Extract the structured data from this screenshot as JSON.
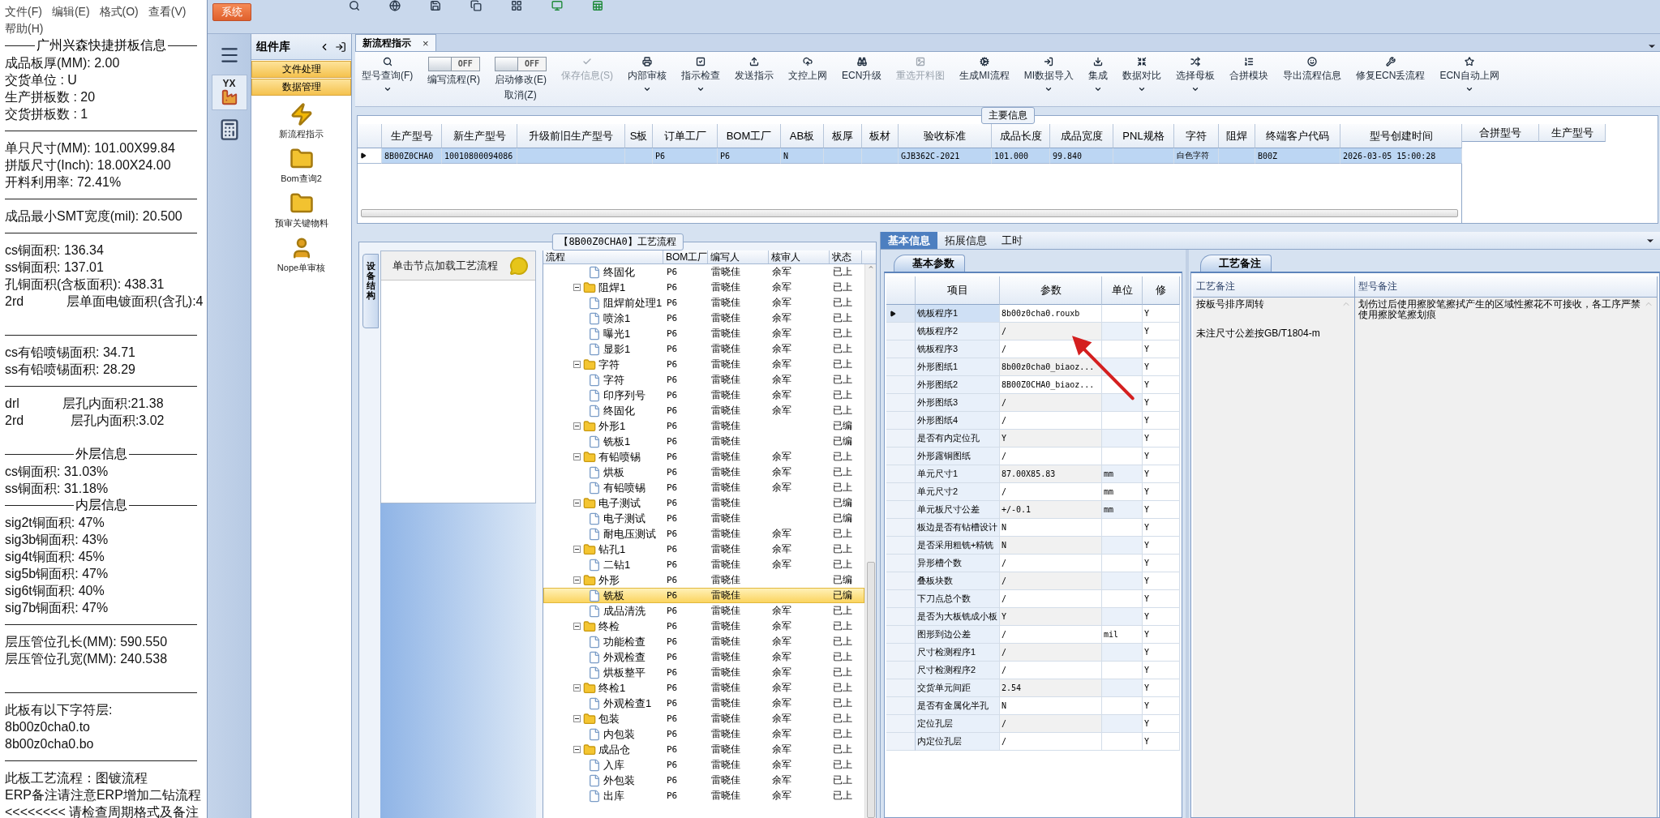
{
  "menu": [
    "文件(F)",
    "编辑(E)",
    "格式(O)",
    "查看(V)",
    "帮助(H)"
  ],
  "info_lines": [
    {
      "kind": "heading",
      "text": "广州兴森快捷拼板信息"
    },
    {
      "kind": "text",
      "text": "成品板厚(MM): 2.00"
    },
    {
      "kind": "text",
      "text": "交货单位 : U"
    },
    {
      "kind": "text",
      "text": "生产拼板数 : 20"
    },
    {
      "kind": "text",
      "text": "交货拼板数 : 1"
    },
    {
      "kind": "rule"
    },
    {
      "kind": "text",
      "text": "单只尺寸(MM): 101.00X99.84"
    },
    {
      "kind": "text",
      "text": "拼版尺寸(Inch): 18.00X24.00"
    },
    {
      "kind": "text",
      "text": "开料利用率: 72.41%"
    },
    {
      "kind": "rule"
    },
    {
      "kind": "text",
      "text": "成品最小SMT宽度(mil): 20.500"
    },
    {
      "kind": "rule"
    },
    {
      "kind": "text",
      "text": "cs铜面积: 136.34"
    },
    {
      "kind": "text",
      "text": "ss铜面积: 137.01"
    },
    {
      "kind": "text",
      "text": "孔铜面积(含板面积): 438.31"
    },
    {
      "kind": "text",
      "text": "2rd            层单面电镀面积(含孔):4"
    },
    {
      "kind": "blank"
    },
    {
      "kind": "rule"
    },
    {
      "kind": "text",
      "text": "cs有铅喷锡面积: 34.71"
    },
    {
      "kind": "text",
      "text": "ss有铅喷锡面积: 28.29"
    },
    {
      "kind": "rule"
    },
    {
      "kind": "text",
      "text": "drl            层孔内面积:21.38"
    },
    {
      "kind": "text",
      "text": "2rd             层孔内面积:3.02"
    },
    {
      "kind": "blank"
    },
    {
      "kind": "heading",
      "text": "外层信息"
    },
    {
      "kind": "text",
      "text": "cs铜面积: 31.03%"
    },
    {
      "kind": "text",
      "text": "ss铜面积: 31.18%"
    },
    {
      "kind": "heading",
      "text": "内层信息"
    },
    {
      "kind": "text",
      "text": "sig2t铜面积: 47%"
    },
    {
      "kind": "text",
      "text": "sig3b铜面积: 43%"
    },
    {
      "kind": "text",
      "text": "sig4t铜面积: 45%"
    },
    {
      "kind": "text",
      "text": "sig5b铜面积: 47%"
    },
    {
      "kind": "text",
      "text": "sig6t铜面积: 40%"
    },
    {
      "kind": "text",
      "text": "sig7b铜面积: 47%"
    },
    {
      "kind": "rule"
    },
    {
      "kind": "text",
      "text": "层压管位孔长(MM): 590.550"
    },
    {
      "kind": "text",
      "text": "层压管位孔宽(MM): 240.538"
    },
    {
      "kind": "blank"
    },
    {
      "kind": "rule"
    },
    {
      "kind": "text",
      "text": "此板有以下字符层:"
    },
    {
      "kind": "text",
      "text": "8b00z0cha0.to"
    },
    {
      "kind": "text",
      "text": "8b00z0cha0.bo"
    },
    {
      "kind": "rule"
    },
    {
      "kind": "text",
      "text": "此板工艺流程：图镀流程"
    },
    {
      "kind": "text",
      "text": "ERP备注请注意ERP增加二钻流程"
    },
    {
      "kind": "text",
      "text": "<<<<<<<< 请检查周期格式及备注"
    }
  ],
  "system_button": "系统",
  "sidebar_logo": "YX",
  "component_library": {
    "title": "组件库",
    "sections": [
      "文件处理",
      "数据管理"
    ],
    "items": [
      {
        "label": "新流程指示"
      },
      {
        "label": "Bom查询2"
      },
      {
        "label": "预审关键物料"
      },
      {
        "label": "Nope单审核"
      }
    ]
  },
  "doc_tab": {
    "label": "新流程指示",
    "close": "×"
  },
  "toolbar": [
    {
      "kind": "button",
      "label": "型号查询(F)",
      "disabled": false,
      "has_menu": true
    },
    {
      "kind": "toggle",
      "label": "编写流程(R)",
      "on": false,
      "state_text": "OFF"
    },
    {
      "kind": "toggle",
      "label": "启动修改(E)",
      "label2": "取消(Z)",
      "on": false,
      "state_text": "OFF"
    },
    {
      "kind": "button",
      "label": "保存信息(S)",
      "disabled": true,
      "has_menu": false
    },
    {
      "kind": "button",
      "label": "内部审核",
      "disabled": false,
      "has_menu": true
    },
    {
      "kind": "button",
      "label": "指示检查",
      "disabled": false,
      "has_menu": true
    },
    {
      "kind": "button",
      "label": "发送指示",
      "disabled": false,
      "has_menu": false
    },
    {
      "kind": "button",
      "label": "文控上网",
      "disabled": false,
      "has_menu": false
    },
    {
      "kind": "button",
      "label": "ECN升级",
      "disabled": false,
      "has_menu": false
    },
    {
      "kind": "button",
      "label": "重选开料图",
      "disabled": true,
      "has_menu": false
    },
    {
      "kind": "button",
      "label": "生成MI流程",
      "disabled": false,
      "has_menu": false
    },
    {
      "kind": "button",
      "label": "MI数据导入",
      "disabled": false,
      "has_menu": true
    },
    {
      "kind": "button",
      "label": "集成",
      "disabled": false,
      "has_menu": true
    },
    {
      "kind": "button",
      "label": "数据对比",
      "disabled": false,
      "has_menu": true
    },
    {
      "kind": "button",
      "label": "选择母板",
      "disabled": false,
      "has_menu": true
    },
    {
      "kind": "button",
      "label": "合拼模块",
      "disabled": false,
      "has_menu": false
    },
    {
      "kind": "button",
      "label": "导出流程信息",
      "disabled": false,
      "has_menu": false
    },
    {
      "kind": "button",
      "label": "修复ECN丢流程",
      "disabled": false,
      "has_menu": false
    },
    {
      "kind": "button",
      "label": "ECN自动上网",
      "disabled": false,
      "has_menu": true
    }
  ],
  "main_info": {
    "title": "主要信息",
    "columns": [
      "生产型号",
      "新生产型号",
      "升级前旧生产型号",
      "S板",
      "订单工厂",
      "BOM工厂",
      "AB板",
      "板厚",
      "板材",
      "验收标准",
      "成品长度",
      "成品宽度",
      "PNL规格",
      "字符",
      "阻焊",
      "终端客户代码",
      "型号创建时间"
    ],
    "rows": [
      {
        "selected": true,
        "cells": [
          "8B00Z0CHA0",
          "10010800094086",
          "",
          "",
          "P6",
          "P6",
          "N",
          "",
          "",
          "GJB362C-2021",
          "101.000",
          "99.840",
          "",
          "白色字符",
          "",
          "B00Z",
          "2026-03-05 15:00:28"
        ]
      }
    ],
    "side_columns": [
      "合拼型号",
      "生产型号"
    ]
  },
  "process": {
    "title": "【8B00Z0CHA0】工艺流程",
    "side_tab": "设备结构",
    "hint": "单击节点加载工艺流程",
    "columns": [
      "流程",
      "BOM工厂",
      "编写人",
      "核审人",
      "状态"
    ],
    "tree": [
      {
        "children": [
          {
            "name": "终固化",
            "factory": "P6",
            "writer": "雷晓佳",
            "reviewer": "余军",
            "status": "已上",
            "selected": false
          }
        ]
      },
      {
        "name": "阻焊1",
        "factory": "P6",
        "writer": "雷晓佳",
        "reviewer": "余军",
        "status": "已上",
        "selected": false,
        "expanded": true,
        "children": [
          {
            "name": "阻焊前处理1",
            "factory": "P6",
            "writer": "雷晓佳",
            "reviewer": "余军",
            "status": "已上",
            "selected": false
          },
          {
            "name": "喷涂1",
            "factory": "P6",
            "writer": "雷晓佳",
            "reviewer": "余军",
            "status": "已上",
            "selected": false
          },
          {
            "name": "曝光1",
            "factory": "P6",
            "writer": "雷晓佳",
            "reviewer": "余军",
            "status": "已上",
            "selected": false
          },
          {
            "name": "显影1",
            "factory": "P6",
            "writer": "雷晓佳",
            "reviewer": "余军",
            "status": "已上",
            "selected": false
          }
        ]
      },
      {
        "name": "字符",
        "factory": "P6",
        "writer": "雷晓佳",
        "reviewer": "余军",
        "status": "已上",
        "selected": false,
        "expanded": true,
        "children": [
          {
            "name": "字符",
            "factory": "P6",
            "writer": "雷晓佳",
            "reviewer": "余军",
            "status": "已上",
            "selected": false
          },
          {
            "name": "印序列号",
            "factory": "P6",
            "writer": "雷晓佳",
            "reviewer": "余军",
            "status": "已上",
            "selected": false
          },
          {
            "name": "终固化",
            "factory": "P6",
            "writer": "雷晓佳",
            "reviewer": "余军",
            "status": "已上",
            "selected": false
          }
        ]
      },
      {
        "name": "外形1",
        "factory": "P6",
        "writer": "雷晓佳",
        "status": "已编",
        "selected": false,
        "expanded": true,
        "children": [
          {
            "name": "铣板1",
            "factory": "P6",
            "writer": "雷晓佳",
            "status": "已编",
            "selected": false
          }
        ]
      },
      {
        "name": "有铅喷锡",
        "factory": "P6",
        "writer": "雷晓佳",
        "reviewer": "余军",
        "status": "已上",
        "selected": false,
        "expanded": true,
        "children": [
          {
            "name": "烘板",
            "factory": "P6",
            "writer": "雷晓佳",
            "reviewer": "余军",
            "status": "已上",
            "selected": false
          },
          {
            "name": "有铅喷锡",
            "factory": "P6",
            "writer": "雷晓佳",
            "reviewer": "余军",
            "status": "已上",
            "selected": false
          }
        ]
      },
      {
        "name": "电子测试",
        "factory": "P6",
        "writer": "雷晓佳",
        "status": "已编",
        "selected": false,
        "expanded": true,
        "children": [
          {
            "name": "电子测试",
            "factory": "P6",
            "writer": "雷晓佳",
            "status": "已编",
            "selected": false
          },
          {
            "name": "耐电压测试",
            "factory": "P6",
            "writer": "雷晓佳",
            "reviewer": "余军",
            "status": "已上",
            "selected": false
          }
        ]
      },
      {
        "name": "钻孔1",
        "factory": "P6",
        "writer": "雷晓佳",
        "reviewer": "余军",
        "status": "已上",
        "selected": false,
        "expanded": true,
        "children": [
          {
            "name": "二钻1",
            "factory": "P6",
            "writer": "雷晓佳",
            "reviewer": "余军",
            "status": "已上",
            "selected": false
          }
        ]
      },
      {
        "name": "外形",
        "factory": "P6",
        "writer": "雷晓佳",
        "status": "已编",
        "selected": false,
        "expanded": true,
        "children": [
          {
            "name": "铣板",
            "factory": "P6",
            "writer": "雷晓佳",
            "status": "已编",
            "selected": true
          },
          {
            "name": "成品清洗",
            "factory": "P6",
            "writer": "雷晓佳",
            "reviewer": "余军",
            "status": "已上",
            "selected": false
          }
        ]
      },
      {
        "name": "终检",
        "factory": "P6",
        "writer": "雷晓佳",
        "reviewer": "余军",
        "status": "已上",
        "selected": false,
        "expanded": true,
        "children": [
          {
            "name": "功能检查",
            "factory": "P6",
            "writer": "雷晓佳",
            "reviewer": "余军",
            "status": "已上",
            "selected": false
          },
          {
            "name": "外观检查",
            "factory": "P6",
            "writer": "雷晓佳",
            "reviewer": "余军",
            "status": "已上",
            "selected": false
          },
          {
            "name": "烘板整平",
            "factory": "P6",
            "writer": "雷晓佳",
            "reviewer": "余军",
            "status": "已上",
            "selected": false
          }
        ]
      },
      {
        "name": "终检1",
        "factory": "P6",
        "writer": "雷晓佳",
        "reviewer": "余军",
        "status": "已上",
        "selected": false,
        "expanded": true,
        "children": [
          {
            "name": "外观检查1",
            "factory": "P6",
            "writer": "雷晓佳",
            "reviewer": "余军",
            "status": "已上",
            "selected": false
          }
        ]
      },
      {
        "name": "包装",
        "factory": "P6",
        "writer": "雷晓佳",
        "reviewer": "余军",
        "status": "已上",
        "selected": false,
        "expanded": true,
        "children": [
          {
            "name": "内包装",
            "factory": "P6",
            "writer": "雷晓佳",
            "reviewer": "余军",
            "status": "已上",
            "selected": false
          }
        ]
      },
      {
        "name": "成品仓",
        "factory": "P6",
        "writer": "雷晓佳",
        "reviewer": "余军",
        "status": "已上",
        "selected": false,
        "expanded": true,
        "children": [
          {
            "name": "入库",
            "factory": "P6",
            "writer": "雷晓佳",
            "reviewer": "余军",
            "status": "已上",
            "selected": false
          },
          {
            "name": "外包装",
            "factory": "P6",
            "writer": "雷晓佳",
            "reviewer": "余军",
            "status": "已上",
            "selected": false
          },
          {
            "name": "出库",
            "factory": "P6",
            "writer": "雷晓佳",
            "reviewer": "余军",
            "status": "已上",
            "selected": false
          }
        ]
      }
    ]
  },
  "detail_tabs": [
    {
      "label": "基本信息",
      "selected": true
    },
    {
      "label": "拓展信息",
      "selected": false
    },
    {
      "label": "工时",
      "selected": false
    }
  ],
  "params": {
    "tab": "基本参数",
    "columns": [
      "项目",
      "参数",
      "单位",
      "修"
    ],
    "rows": [
      {
        "item": "铣板程序1",
        "value": "8b00z0cha0.rouxb",
        "modified": "Y",
        "selected": true
      },
      {
        "item": "铣板程序2",
        "value": "/",
        "modified": "Y",
        "selected": false
      },
      {
        "item": "铣板程序3",
        "value": "/",
        "modified": "Y",
        "selected": false
      },
      {
        "item": "外形图纸1",
        "value": "8b00z0cha0_biaoz...",
        "modified": "Y",
        "selected": false
      },
      {
        "item": "外形图纸2",
        "value": "8B00Z0CHA0_biaoz...",
        "modified": "Y",
        "selected": false
      },
      {
        "item": "外形图纸3",
        "value": "/",
        "modified": "Y",
        "selected": false
      },
      {
        "item": "外形图纸4",
        "value": "/",
        "modified": "Y",
        "selected": false
      },
      {
        "item": "是否有内定位孔",
        "value": "Y",
        "modified": "Y",
        "selected": false
      },
      {
        "item": "外形露铜图纸",
        "value": "/",
        "modified": "Y",
        "selected": false
      },
      {
        "item": "单元尺寸1",
        "value": "87.00X85.83",
        "unit": "mm",
        "modified": "Y",
        "selected": false
      },
      {
        "item": "单元尺寸2",
        "value": "/",
        "unit": "mm",
        "modified": "Y",
        "selected": false
      },
      {
        "item": "单元板尺寸公差",
        "value": "+/-0.1",
        "unit": "mm",
        "modified": "Y",
        "selected": false
      },
      {
        "item": "板边是否有钻槽设计",
        "value": "N",
        "modified": "Y",
        "selected": false
      },
      {
        "item": "是否采用粗铣+精铣",
        "value": "N",
        "modified": "Y",
        "selected": false
      },
      {
        "item": "异形槽个数",
        "value": "/",
        "modified": "Y",
        "selected": false
      },
      {
        "item": "叠板块数",
        "value": "/",
        "modified": "Y",
        "selected": false
      },
      {
        "item": "下刀点总个数",
        "value": "/",
        "modified": "Y",
        "selected": false
      },
      {
        "item": "是否为大板铣成小板",
        "value": "Y",
        "modified": "Y",
        "selected": false
      },
      {
        "item": "图形到边公差",
        "value": "/",
        "unit": "mil",
        "modified": "Y",
        "selected": false
      },
      {
        "item": "尺寸检测程序1",
        "value": "/",
        "modified": "Y",
        "selected": false
      },
      {
        "item": "尺寸检测程序2",
        "value": "/",
        "modified": "Y",
        "selected": false
      },
      {
        "item": "交货单元间距",
        "value": "2.54",
        "modified": "Y",
        "selected": false
      },
      {
        "item": "是否有金属化半孔",
        "value": "N",
        "modified": "Y",
        "selected": false
      },
      {
        "item": "定位孔层",
        "value": "/",
        "modified": "Y",
        "selected": false
      },
      {
        "item": "内定位孔层",
        "value": "/",
        "modified": "Y",
        "selected": false
      }
    ]
  },
  "remarks": {
    "tab": "工艺备注",
    "columns": [
      "工艺备注",
      "型号备注"
    ],
    "process_notes": [
      "按板号排序周转",
      "未注尺寸公差按GB/T1804-m"
    ],
    "model_note": "划伤过后使用擦胶笔擦拭产生的区域性擦花不可接收，各工序严禁使用擦胶笔擦划痕"
  }
}
